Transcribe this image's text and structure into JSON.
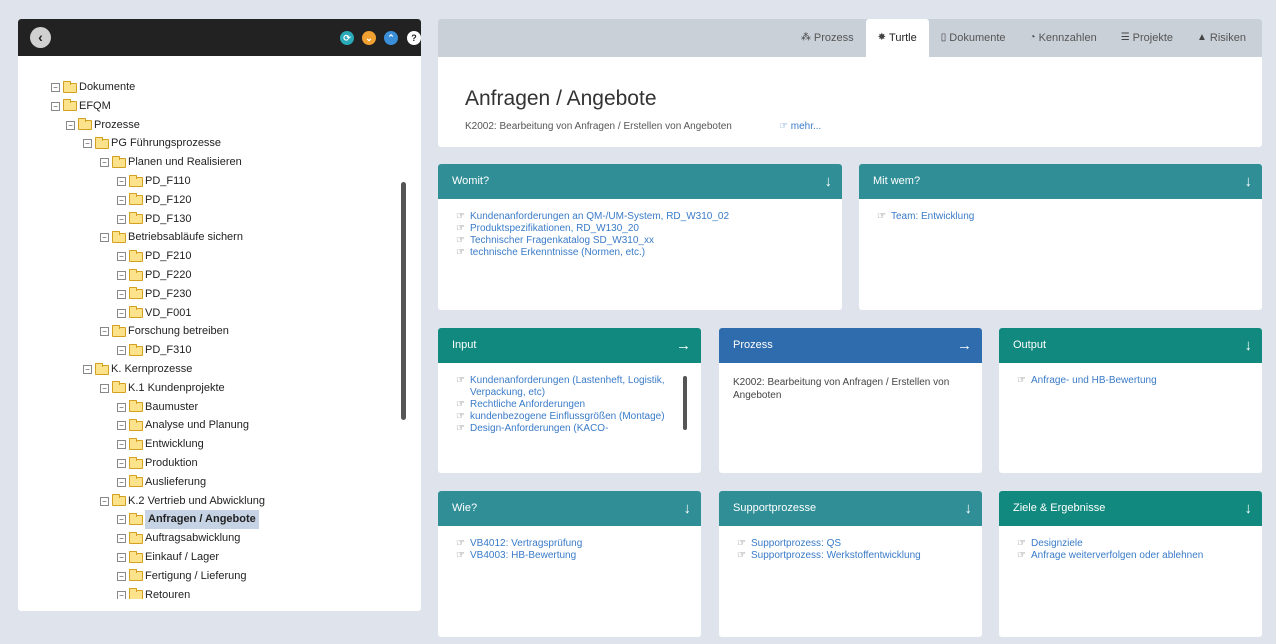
{
  "tree": {
    "header_icons": [
      {
        "name": "refresh-icon",
        "color": "#2aa9b8",
        "glyph": "⟳"
      },
      {
        "name": "chevron-down-icon",
        "color": "#f0a030",
        "glyph": "⌄"
      },
      {
        "name": "chevron-up-icon",
        "color": "#3a8fd8",
        "glyph": "⌃"
      },
      {
        "name": "help-icon",
        "color": "#ffffff",
        "glyph": "?"
      }
    ],
    "nodes": [
      {
        "label": "Dokumente",
        "level": 0
      },
      {
        "label": "EFQM",
        "level": 0
      },
      {
        "label": "Prozesse",
        "level": 1
      },
      {
        "label": "PG Führungsprozesse",
        "level": 2
      },
      {
        "label": "Planen und Realisieren",
        "level": 3
      },
      {
        "label": "PD_F110",
        "level": 4
      },
      {
        "label": "PD_F120",
        "level": 4
      },
      {
        "label": "PD_F130",
        "level": 4
      },
      {
        "label": "Betriebsabläufe sichern",
        "level": 3
      },
      {
        "label": "PD_F210",
        "level": 4
      },
      {
        "label": "PD_F220",
        "level": 4
      },
      {
        "label": "PD_F230",
        "level": 4
      },
      {
        "label": "VD_F001",
        "level": 4
      },
      {
        "label": "Forschung betreiben",
        "level": 3
      },
      {
        "label": "PD_F310",
        "level": 4
      },
      {
        "label": "K. Kernprozesse",
        "level": 2
      },
      {
        "label": "K.1 Kundenprojekte",
        "level": 3
      },
      {
        "label": "Baumuster",
        "level": 4
      },
      {
        "label": "Analyse und Planung",
        "level": 4
      },
      {
        "label": "Entwicklung",
        "level": 4
      },
      {
        "label": "Produktion",
        "level": 4
      },
      {
        "label": "Auslieferung",
        "level": 4
      },
      {
        "label": "K.2 Vertrieb und Abwicklung",
        "level": 3
      },
      {
        "label": "Anfragen / Angebote",
        "level": 4,
        "selected": true
      },
      {
        "label": "Auftragsabwicklung",
        "level": 4
      },
      {
        "label": "Einkauf / Lager",
        "level": 4
      },
      {
        "label": "Fertigung / Lieferung",
        "level": 4
      },
      {
        "label": "Retouren",
        "level": 4
      }
    ]
  },
  "tabs": [
    {
      "label": "Prozess",
      "icon": "sitemap-icon",
      "glyph": "⁂",
      "active": false
    },
    {
      "label": "Turtle",
      "icon": "bug-icon",
      "glyph": "✸",
      "active": true
    },
    {
      "label": "Dokumente",
      "icon": "document-icon",
      "glyph": "▯",
      "active": false
    },
    {
      "label": "Kennzahlen",
      "icon": "gauge-icon",
      "glyph": "◔",
      "active": false
    },
    {
      "label": "Projekte",
      "icon": "list-icon",
      "glyph": "☰",
      "active": false
    },
    {
      "label": "Risiken",
      "icon": "warning-icon",
      "glyph": "▲",
      "active": false
    }
  ],
  "page": {
    "title": "Anfragen / Angebote",
    "subtitle": "K2002: Bearbeitung von Anfragen / Erstellen von Angeboten",
    "more_link": "mehr..."
  },
  "cards": {
    "womit": {
      "title": "Womit?",
      "items": [
        "Kundenanforderungen an QM-/UM-System, RD_W310_02",
        "Produktspezifikationen, RD_W130_20",
        "Technischer Fragenkatalog SD_W310_xx",
        "technische Erkenntnisse (Normen, etc.)"
      ]
    },
    "mitwem": {
      "title": "Mit wem?",
      "items": [
        "Team: Entwicklung"
      ]
    },
    "input": {
      "title": "Input",
      "items": [
        "Kundenanforderungen (Lastenheft, Logistik, Verpackung, etc)",
        "Rechtliche Anforderungen",
        "kundenbezogene Einflussgrößen (Montage)",
        "Design-Anforderungen (KACO-"
      ]
    },
    "prozess": {
      "title": "Prozess",
      "text": "K2002: Bearbeitung von Anfragen / Erstellen von Angeboten"
    },
    "output": {
      "title": "Output",
      "items": [
        "Anfrage- und HB-Bewertung"
      ]
    },
    "wie": {
      "title": "Wie?",
      "items": [
        "VB4012: Vertragsprüfung",
        "VB4003: HB-Bewertung"
      ]
    },
    "support": {
      "title": "Supportprozesse",
      "items": [
        "Supportprozess: QS",
        "Supportprozess: Werkstoffentwicklung"
      ]
    },
    "ziele": {
      "title": "Ziele & Ergebnisse",
      "items": [
        "Designziele",
        "Anfrage weiterverfolgen oder ablehnen"
      ]
    }
  },
  "colors": {
    "teal": "#2f8e96",
    "green": "#12897e",
    "blue": "#2e6cad",
    "link": "#3a7bc8",
    "background": "#dfe4ec"
  }
}
